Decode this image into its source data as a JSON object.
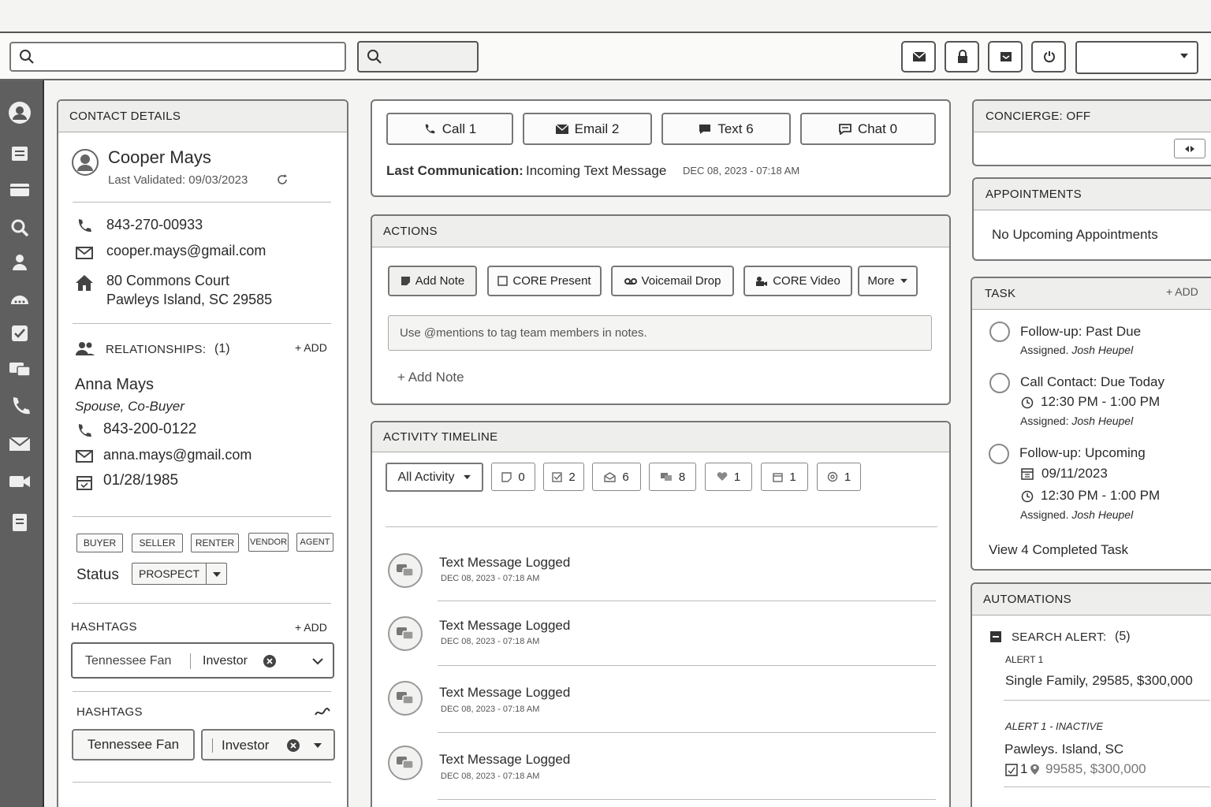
{
  "colors": {
    "rail": "#5f5f5f",
    "border": "#777777",
    "panel_head": "#eeeeec"
  },
  "contact": {
    "header": "CONTACT DETAILS",
    "name": "Cooper Mays",
    "validated": "Last Validated: 09/03/2023",
    "phone": "843-270-00933",
    "email": "cooper.mays@gmail.com",
    "address1": "80 Commons Court",
    "address2": "Pawleys Island, SC 29585",
    "relationships_label": "RELATIONSHIPS:",
    "relationships_count": "(1)",
    "add": "+ ADD",
    "rel_name": "Anna Mays",
    "rel_role": "Spouse, Co-Buyer",
    "rel_phone": "843-200-0122",
    "rel_email": "anna.mays@gmail.com",
    "rel_dob": "01/28/1985",
    "types": [
      "BUYER",
      "SELLER",
      "RENTER",
      "VENDOR",
      "AGENT"
    ],
    "status_label": "Status",
    "status_value": "PROSPECT",
    "hashtags_label_1": "HASHTAGS",
    "hashtags_label_2": "HASHTAGS",
    "tag1": "Tennessee Fan",
    "tag2": "Investor"
  },
  "comms": {
    "call": "Call 1",
    "email": "Email 2",
    "text": "Text 6",
    "chat": "Chat 0",
    "last_label": "Last Communication:",
    "last_value": "Incoming Text Message",
    "last_time": "DEC 08, 2023 - 07:18 AM"
  },
  "actions": {
    "header": "ACTIONS",
    "add_note": "Add Note",
    "core_present": "CORE Present",
    "voicemail": "Voicemail Drop",
    "core_video": "CORE Video",
    "more": "More",
    "placeholder": "Use @mentions to tag team members in notes.",
    "add_note_link": "+ Add Note"
  },
  "timeline": {
    "header": "ACTIVITY TIMELINE",
    "filter_all": "All Activity",
    "counts": [
      "0",
      "2",
      "6",
      "8",
      "1",
      "1",
      "1"
    ],
    "items": [
      {
        "title": "Text Message Logged",
        "time": "DEC 08, 2023 - 07:18 AM"
      },
      {
        "title": "Text Message Logged",
        "time": "DEC 08, 2023 - 07:18 AM"
      },
      {
        "title": "Text Message Logged",
        "time": "DEC 08, 2023 - 07:18 AM"
      },
      {
        "title": "Text Message Logged",
        "time": "DEC 08, 2023 - 07:18 AM"
      }
    ]
  },
  "concierge": {
    "header": "CONCIERGE: OFF"
  },
  "appointments": {
    "header": "APPOINTMENTS",
    "empty": "No Upcoming Appointments"
  },
  "tasks": {
    "header": "TASK",
    "add": "+ ADD",
    "t1_title": "Follow-up: Past Due",
    "t1_assigned": "Assigned.",
    "t1_who": "Josh Heupel",
    "t2_title": "Call Contact: Due Today",
    "t2_time": "12:30 PM - 1:00 PM",
    "t2_assigned": "Assigned:",
    "t2_who": "Josh Heupel",
    "t3_title": "Follow-up: Upcoming",
    "t3_date": "09/11/2023",
    "t3_time": "12:30 PM - 1:00 PM",
    "t3_assigned": "Assigned.",
    "t3_who": "Josh Heupel",
    "completed": "View 4 Completed Task"
  },
  "automations": {
    "header": "AUTOMATIONS",
    "search_alert": "SEARCH ALERT:",
    "search_count": "(5)",
    "a1_label": "ALERT 1",
    "a1_value": "Single Family, 29585, $300,000",
    "a2_label": "ALERT 1 - INACTIVE",
    "a2_line1": "Pawleys. Island, SC",
    "a2_prefix": "1",
    "a2_line2": "99585, $300,000"
  }
}
